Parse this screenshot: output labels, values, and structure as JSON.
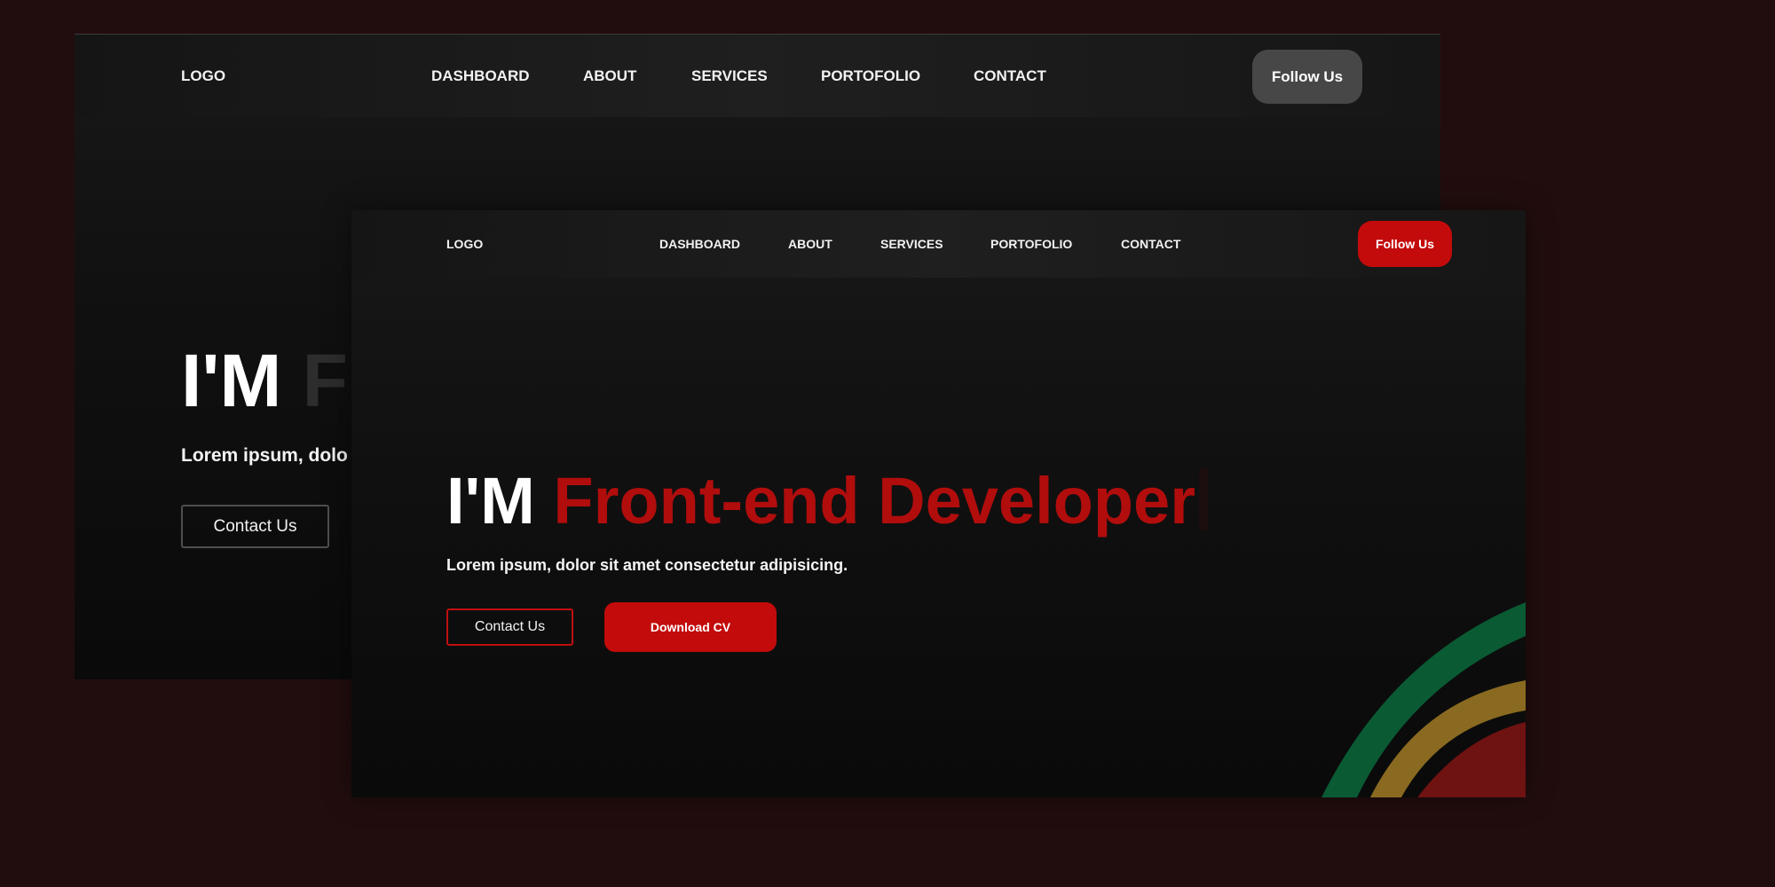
{
  "back_page": {
    "nav": {
      "logo": "LOGO",
      "links": [
        "DASHBOARD",
        "ABOUT",
        "SERVICES",
        "PORTOFOLIO",
        "CONTACT"
      ],
      "follow_label": "Follow Us"
    },
    "hero": {
      "intro": "I'M",
      "role_fragment": "F",
      "subtitle_fragment": "Lorem ipsum, dolo",
      "contact_label": "Contact Us"
    }
  },
  "front_page": {
    "nav": {
      "logo": "LOGO",
      "links": [
        "DASHBOARD",
        "ABOUT",
        "SERVICES",
        "PORTOFOLIO",
        "CONTACT"
      ],
      "follow_label": "Follow Us"
    },
    "hero": {
      "intro": "I'M",
      "role": "Front-end Developer",
      "subtitle": "Lorem ipsum, dolor sit amet consectetur adipisicing.",
      "contact_label": "Contact Us",
      "download_label": "Download CV"
    }
  },
  "colors": {
    "background": "#220d0e",
    "accent_red": "#c30b0b",
    "follow_back": "#474747",
    "decor_green": "#0a5a34",
    "decor_gold": "#8a6a20",
    "decor_red": "#6e1212"
  }
}
